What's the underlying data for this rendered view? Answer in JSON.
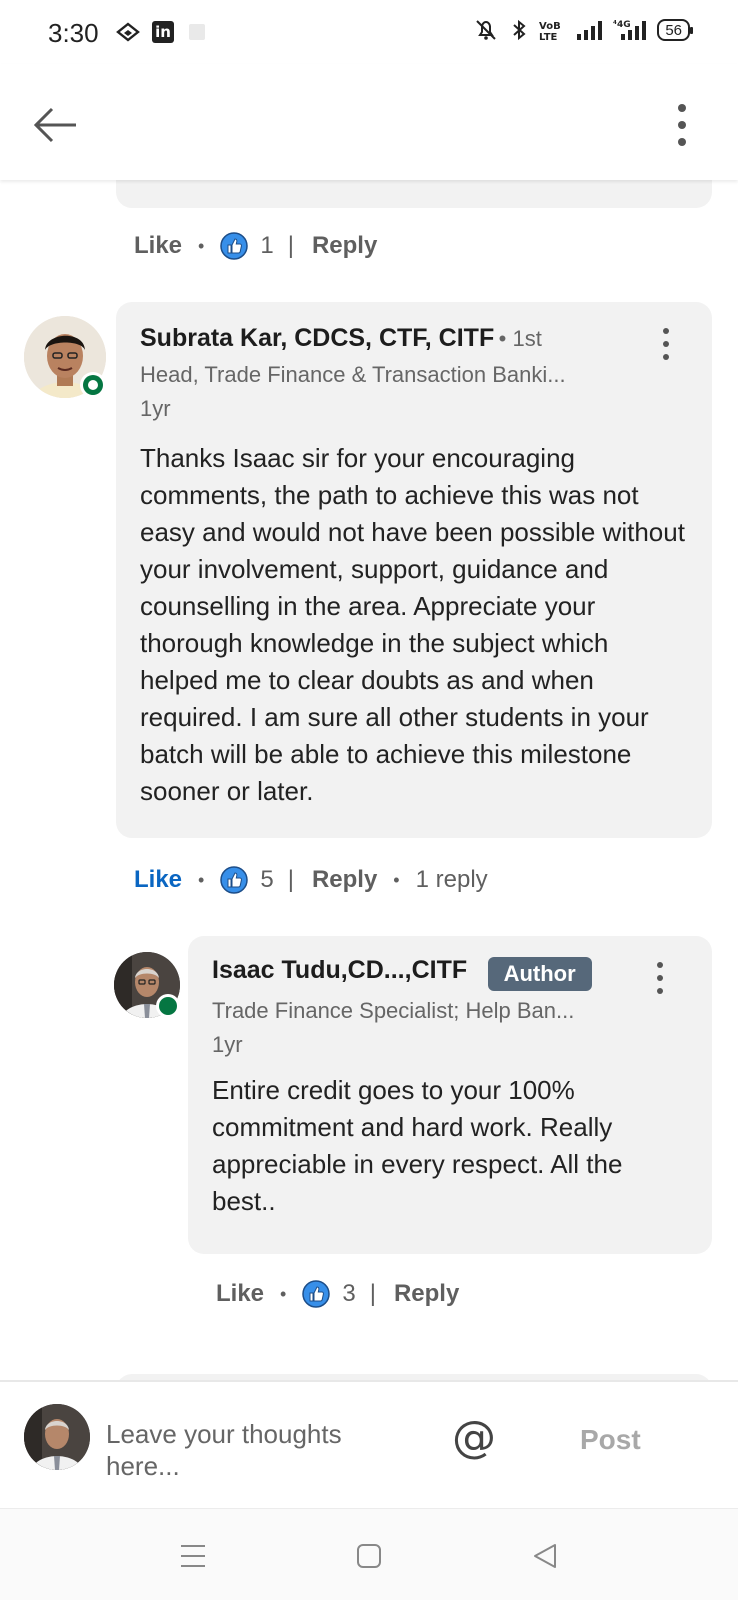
{
  "status_bar": {
    "time": "3:30",
    "battery": "56",
    "network": "4G"
  },
  "header": {
    "back_icon": "arrow-left-icon",
    "more_icon": "vertical-dots-icon"
  },
  "previous_comment_actions": {
    "like_label": "Like",
    "reaction_count": "1",
    "reply_label": "Reply"
  },
  "comment_1": {
    "author": "Subrata Kar, CDCS, CTF, CITF",
    "degree": "• 1st",
    "headline": "Head, Trade Finance & Transaction Banki...",
    "time": "1yr",
    "text": "Thanks Isaac sir for your encouraging comments, the path to achieve this was not easy and would not have been possible without your involvement, support, guidance and counselling in the area. Appreciate your thorough knowledge in the subject which helped me to clear doubts as and when required. I am sure all other students in your batch will be able to achieve this milestone sooner or later.",
    "like_label": "Like",
    "reaction_count": "5",
    "reply_label": "Reply",
    "replies_label": "1 reply"
  },
  "reply_1": {
    "author": "Isaac Tudu,CD...,CITF",
    "badge": "Author",
    "headline": "Trade Finance Specialist; Help Ban...",
    "time": "1yr",
    "text": "Entire credit goes to your 100% commitment and hard work. Really appreciable in every respect. All the best..",
    "like_label": "Like",
    "reaction_count": "3",
    "reply_label": "Reply"
  },
  "composer": {
    "placeholder": "Leave your thoughts here...",
    "mention_symbol": "@",
    "post_label": "Post"
  },
  "colors": {
    "accent": "#0a66c2",
    "presence": "#057642",
    "author_badge": "#56687a",
    "bubble": "#f2f2f2"
  }
}
